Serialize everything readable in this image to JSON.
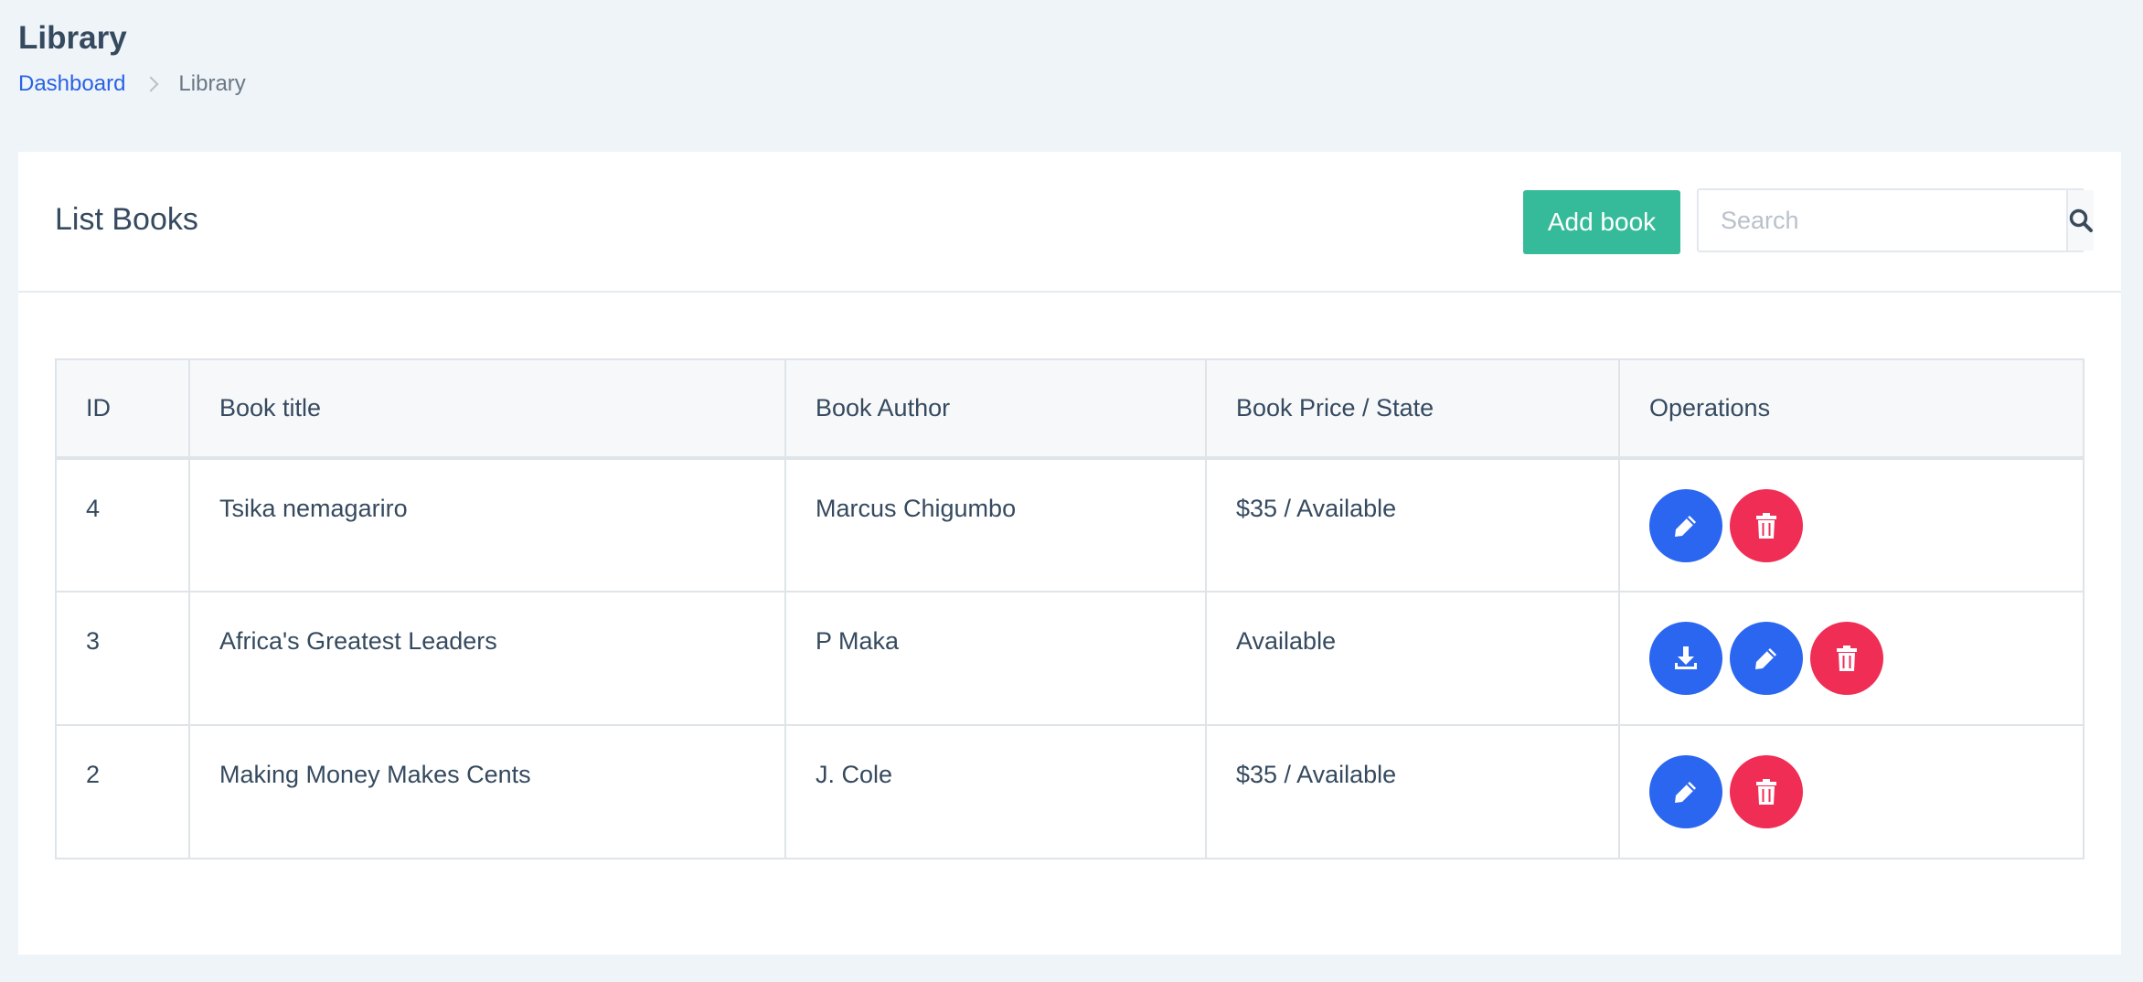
{
  "header": {
    "title": "Library",
    "breadcrumb": [
      {
        "label": "Dashboard"
      },
      {
        "label": "Library"
      }
    ]
  },
  "card": {
    "title": "List Books",
    "add_label": "Add book",
    "search_placeholder": "Search"
  },
  "table": {
    "columns": [
      "ID",
      "Book title",
      "Book Author",
      "Book Price / State",
      "Operations"
    ],
    "rows": [
      {
        "id": "4",
        "title": "Tsika nemagariro",
        "author": "Marcus Chigumbo",
        "price_state": "$35 / Available",
        "operations": [
          "edit",
          "delete"
        ]
      },
      {
        "id": "3",
        "title": "Africa's Greatest Leaders",
        "author": "P Maka",
        "price_state": "Available",
        "operations": [
          "download",
          "edit",
          "delete"
        ]
      },
      {
        "id": "2",
        "title": "Making Money Makes Cents",
        "author": "J. Cole",
        "price_state": "$35 / Available",
        "operations": [
          "edit",
          "delete"
        ]
      }
    ]
  },
  "colors": {
    "accent_green": "#36bb9a",
    "action_blue": "#2b66f0",
    "action_red": "#ef2d55",
    "link_blue": "#2a62e6"
  },
  "icons": {
    "search": "search-icon",
    "edit": "pencil-icon",
    "delete": "trash-icon",
    "download": "download-icon"
  }
}
